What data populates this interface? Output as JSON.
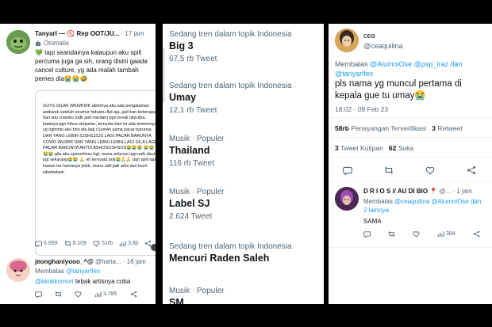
{
  "left": {
    "tweet1": {
      "name": "TanyarI — 🚫 Rep OOT/JU...",
      "time": "· 17 jam",
      "automated": "Otomatis",
      "text_lines": [
        "💚 tapi seandainya kalaupun aku spill",
        "percuma juga ga sih, orang disini gaada",
        "cancel culture, yg ada malah tambah",
        "pemes dia😭😭🤣"
      ],
      "card_text": "GUYS GILAK WKWKWK akhirnya aku ada pengalaman awikwok setelah seumur hidupku flat aja, jadi kan beberapa hari lalu cowoku (udh jadi mantan) pgn break tiba-tiba, katanya pgn fokus skripsian, ternyata hari ini ada temenmya yg ngirimin aku foto dia lagi c1um4n sama pacar barunya DAN YANG LEBIH SJSHSJSJS LAGI PACAR BARUNYA COWO ANJIRR DAN YANG LEBIH LEBIH LAGI GILA LAGI PACAR BARUNYA ARTIS ASHOSOSHSOS😭😭😭 😭😭😭😭 gila aku speachless bgt, mana artisnya lagi naik daun bgt sekarang😭😭 🙏 eh ternyata boti😭🙏🙏 pgn spill tapi kasian tar namanya jelek, mana udh jadi artis dari kecil wkwkwkwk.",
      "stats": {
        "replies": "6.859",
        "retweets": "8.109",
        "likes": "51rb",
        "views": "3,8jt"
      }
    },
    "tweet2": {
      "name": "jeonghaniyooo_^@",
      "handle": "@haha...",
      "time": "· 16 jam",
      "reply_prefix": "Membalas",
      "reply_to": "@tanyarlfes",
      "mention": "@kkokkomori",
      "text": "tebak artisnya coba",
      "stats": {
        "replies": "",
        "retweets": "",
        "likes": "",
        "views": "3.785"
      }
    }
  },
  "trends": [
    {
      "category": "Sedang tren dalam topik Indonesia",
      "name": "Big 3",
      "count": "67,5 rb Tweet"
    },
    {
      "category": "Sedang tren dalam topik Indonesia",
      "name": "Umay",
      "count": "12,1 rb Tweet"
    },
    {
      "category": "Musik · Populer",
      "name": "Thailand",
      "count": "116 rb Tweet"
    },
    {
      "category": "Musik · Populer",
      "name": "Label SJ",
      "count": "2.624 Tweet"
    },
    {
      "category": "Sedang tren dalam topik Indonesia",
      "name": "Mencuri Raden Saleh",
      "count": ""
    },
    {
      "category": "Musik · Populer",
      "name": "SM...",
      "count": ""
    }
  ],
  "right": {
    "main": {
      "name": "cea",
      "handle": "@ceaquilina",
      "reply_prefix": "Membalas",
      "reply_to_1": "@AlumniOse @psp_iraz dan",
      "reply_to_2": "@tanyarlfes",
      "text_lines": [
        "pls nama yg muncul pertama di",
        "kepala gue tu umay😭"
      ],
      "datetime": "18:02 · 09 Feb 23",
      "verified_views": "58rb",
      "verified_views_label": "Penayangan Terverifikasi",
      "retweets": "3",
      "retweets_label": "Retweet",
      "quotes": "3",
      "quotes_label": "Tweet Kutipan",
      "likes": "62",
      "likes_label": "Suka"
    },
    "reply": {
      "name": "D R I O S // AU DI BIO 📍",
      "handle": "@...",
      "time": "· 1 jam",
      "reply_prefix": "Membalas",
      "reply_to_1": "@ceaquilina @AlumniOse dan",
      "reply_to_2": "2 lainnya",
      "text": "SAMA",
      "views": "384"
    }
  },
  "colors": {
    "accent": "#1d9bf0",
    "muted": "#536471",
    "border": "#cfd9de"
  },
  "icons": [
    "reply-icon",
    "retweet-icon",
    "like-icon",
    "views-icon",
    "share-icon",
    "automated-bot-icon",
    "mute-icon"
  ]
}
